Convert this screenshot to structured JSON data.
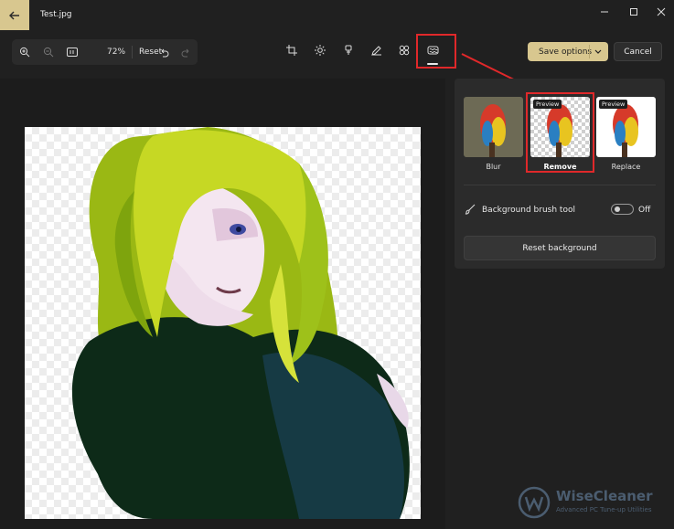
{
  "window": {
    "title": "Test.jpg"
  },
  "zoom_toolbar": {
    "zoom_value": "72%",
    "reset_label": "Reset"
  },
  "actions": {
    "save_label": "Save options",
    "cancel_label": "Cancel"
  },
  "background_panel": {
    "options": [
      {
        "label": "Blur",
        "preview_tag": "",
        "selected": false
      },
      {
        "label": "Remove",
        "preview_tag": "Preview",
        "selected": true
      },
      {
        "label": "Replace",
        "preview_tag": "Preview",
        "selected": false
      }
    ],
    "brush_tool_label": "Background brush tool",
    "brush_tool_state": "Off",
    "reset_label": "Reset background"
  },
  "watermark": {
    "title": "WiseCleaner",
    "subtitle": "Advanced PC Tune-up Utilities"
  },
  "colors": {
    "accent": "#d8c78f",
    "highlight": "#e0282a",
    "background": "#202020"
  }
}
